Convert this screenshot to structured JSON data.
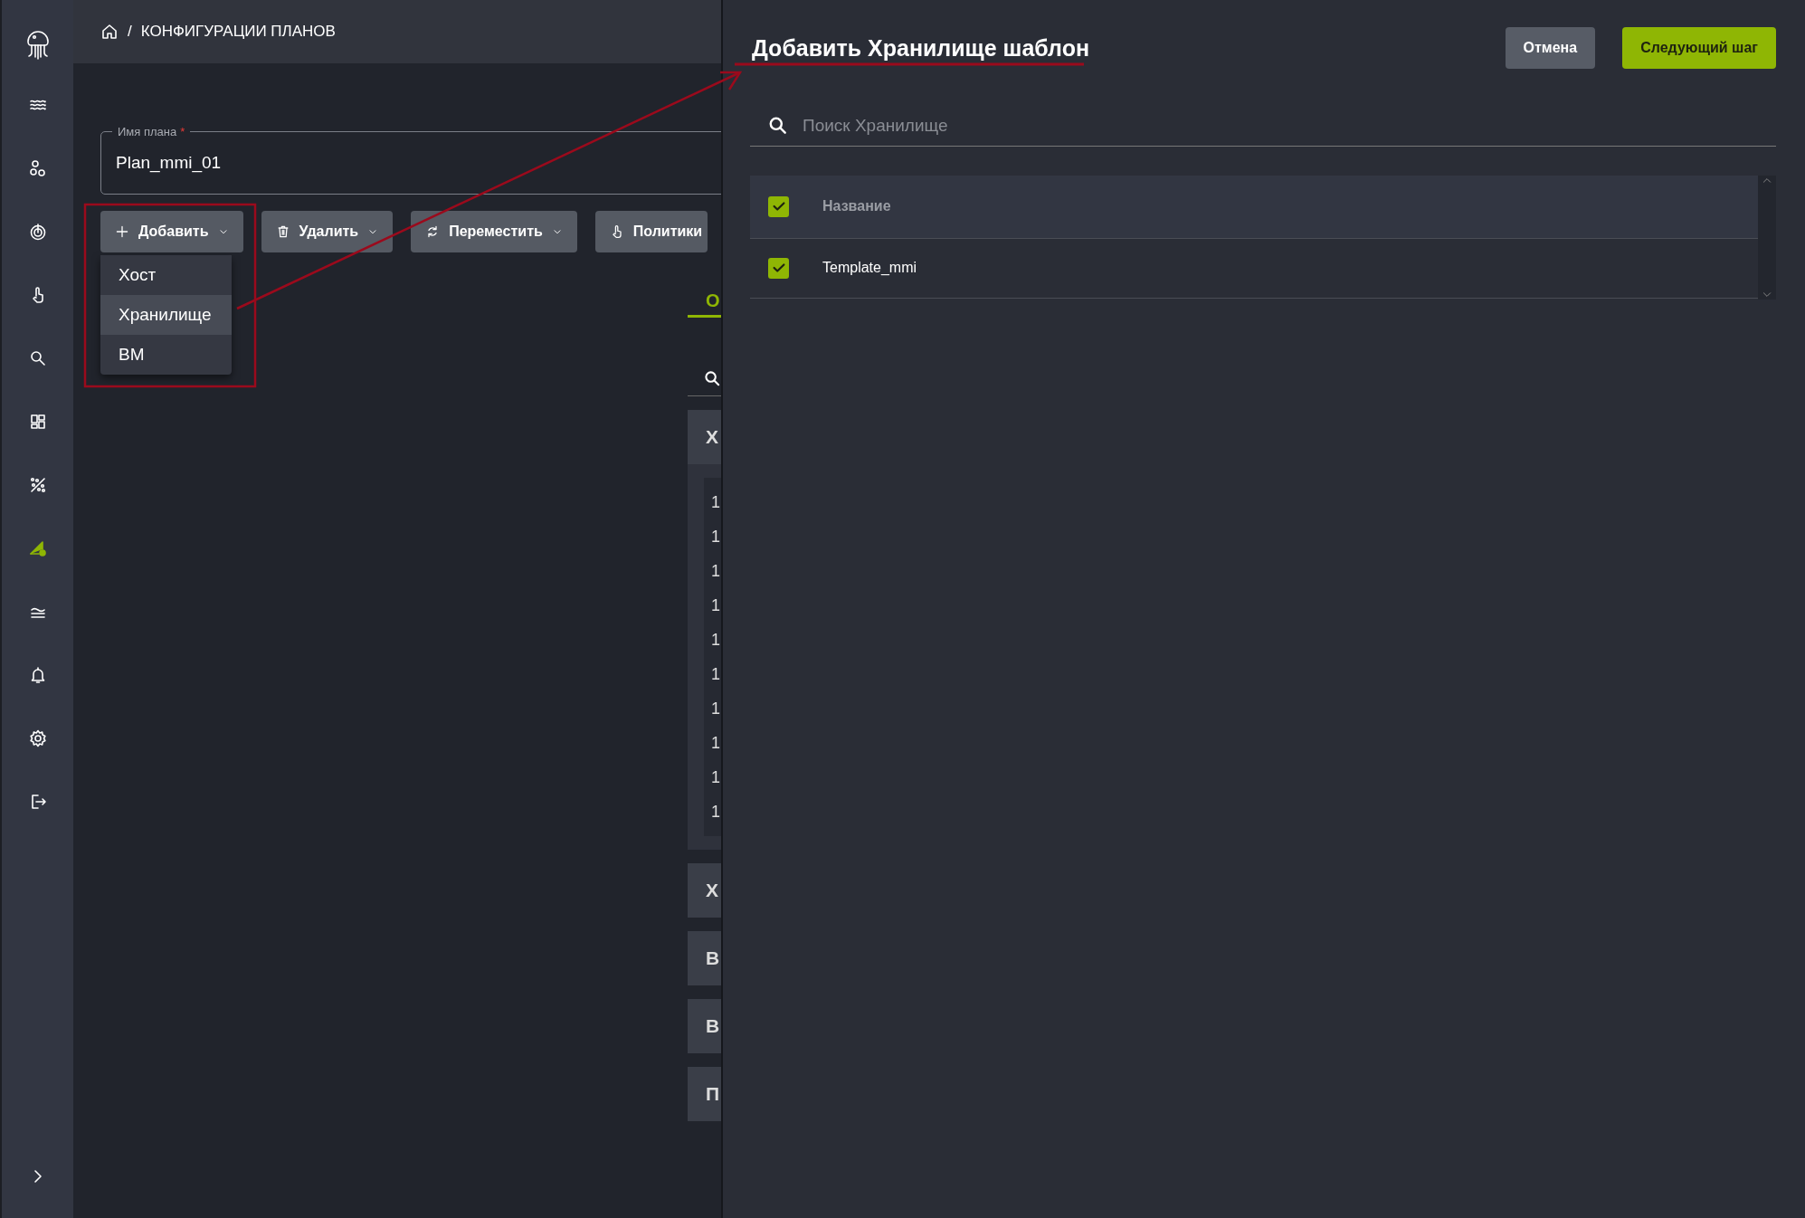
{
  "breadcrumb": {
    "path": "КОНФИГУРАЦИИ ПЛАНОВ",
    "separator": "/"
  },
  "sidebar": {
    "items": [
      {
        "selected": false
      },
      {
        "selected": false
      },
      {
        "selected": false
      },
      {
        "selected": false
      },
      {
        "selected": false
      },
      {
        "selected": false
      },
      {
        "selected": false
      },
      {
        "selected": true
      },
      {
        "selected": false
      },
      {
        "selected": false
      },
      {
        "selected": false
      },
      {
        "selected": false
      }
    ]
  },
  "plan_name": {
    "label": "Имя плана",
    "required_mark": "*",
    "value": "Plan_mmi_01"
  },
  "toolbar": [
    {
      "label": "Добавить",
      "kind": "plus",
      "has_caret": true
    },
    {
      "label": "Удалить",
      "kind": "trash",
      "has_caret": true
    },
    {
      "label": "Переместить",
      "kind": "refresh",
      "has_caret": true
    },
    {
      "label": "Политики",
      "kind": "hand",
      "has_caret": false
    }
  ],
  "add_menu": {
    "expanded": true,
    "items": [
      {
        "label": "Хост",
        "selected": false
      },
      {
        "label": "Хранилище",
        "selected": true
      },
      {
        "label": "ВМ",
        "selected": false
      }
    ]
  },
  "behind_panel": {
    "tab": {
      "label": "О",
      "selected": true
    },
    "sections": [
      {
        "title": "Х",
        "rows": [
          "1",
          "1",
          "1",
          "1",
          "1",
          "1",
          "1",
          "1",
          "1",
          "1"
        ]
      },
      {
        "title": "Х"
      },
      {
        "title": "В"
      },
      {
        "title": "В"
      },
      {
        "title": "П"
      }
    ]
  },
  "drawer": {
    "title": "Добавить Хранилище шаблон",
    "buttons": [
      {
        "label": "Отмена",
        "kind": "secondary"
      },
      {
        "label": "Следующий шаг",
        "kind": "primary"
      }
    ],
    "search": {
      "placeholder": "Поиск Хранилище"
    },
    "table": {
      "all_checked": true,
      "columns": [
        "Название"
      ],
      "rows": [
        {
          "name": "Template_mmi",
          "checked": true
        }
      ]
    }
  }
}
